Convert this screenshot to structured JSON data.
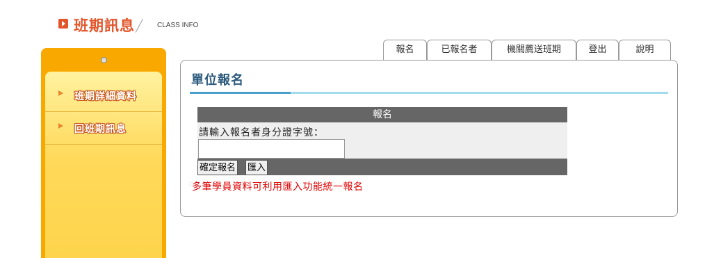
{
  "header": {
    "title": "班期訊息",
    "subtitle": "CLASS INFO"
  },
  "sidebar": {
    "items": [
      {
        "label": "班期詳細資料"
      },
      {
        "label": "回班期訊息"
      }
    ]
  },
  "tabs": [
    {
      "label": "報名"
    },
    {
      "label": "已報名者"
    },
    {
      "label": "機關薦送班期"
    },
    {
      "label": "登出"
    },
    {
      "label": "說明"
    }
  ],
  "panel": {
    "title": "單位報名",
    "form": {
      "header": "報名",
      "prompt": "請輸入報名者身分證字號：",
      "input_value": "",
      "confirm_label": "確定報名",
      "import_label": "匯入"
    },
    "note": "多筆學員資料可利用匯入功能統一報名"
  },
  "colors": {
    "accent_orange": "#e2562c",
    "sidebar_yellow": "#f9a800",
    "title_blue": "#2c5b7e",
    "note_red": "#e00000"
  }
}
